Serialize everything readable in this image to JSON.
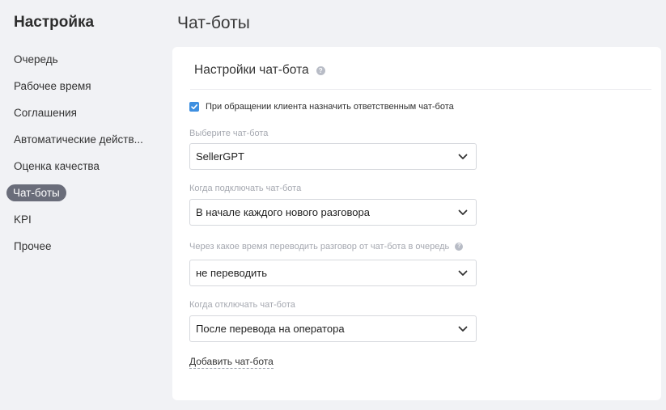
{
  "sidebar": {
    "title": "Настройка",
    "items": [
      {
        "label": "Очередь"
      },
      {
        "label": "Рабочее время"
      },
      {
        "label": "Соглашения"
      },
      {
        "label": "Автоматические действ..."
      },
      {
        "label": "Оценка качества"
      },
      {
        "label": "Чат-боты"
      },
      {
        "label": "KPI"
      },
      {
        "label": "Прочее"
      }
    ]
  },
  "header": {
    "title": "Чат-боты"
  },
  "card": {
    "title": "Настройки чат-бота",
    "checkbox": {
      "label": "При обращении клиента назначить ответственным чат-бота",
      "checked": true
    },
    "fields": [
      {
        "label": "Выберите чат-бота",
        "value": "SellerGPT"
      },
      {
        "label": "Когда подключать чат-бота",
        "value": "В начале каждого нового разговора"
      },
      {
        "label": "Через какое время переводить разговор от чат-бота в очередь",
        "value": "не переводить"
      },
      {
        "label": "Когда отключать чат-бота",
        "value": "После перевода на оператора"
      }
    ],
    "add_link": "Добавить чат-бота"
  },
  "colors": {
    "accent": "#3e8fe0",
    "active_nav": "#6a6d7a",
    "background": "#f1f2f5"
  }
}
